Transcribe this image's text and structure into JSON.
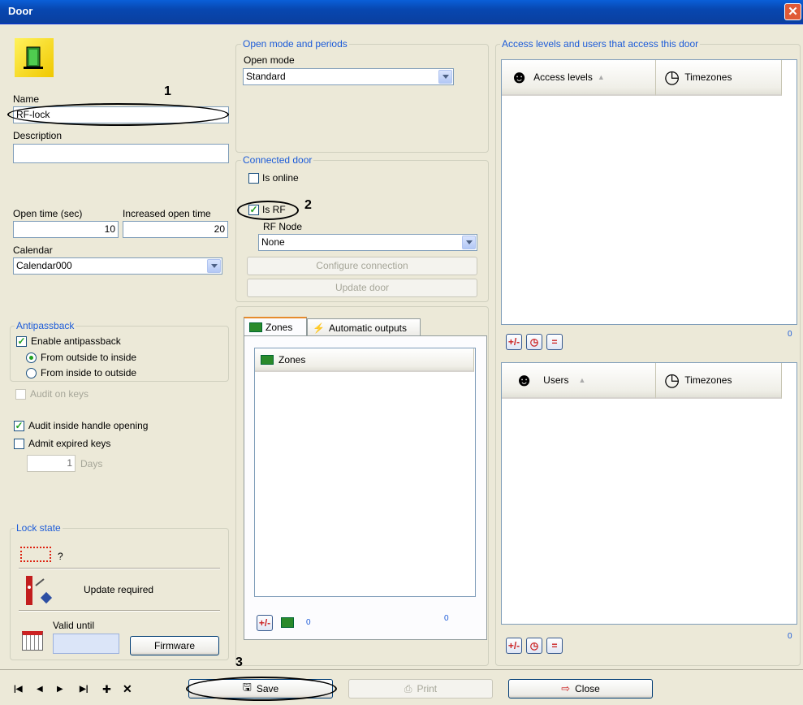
{
  "window": {
    "title": "Door",
    "close_glyph": "✕"
  },
  "name": {
    "label": "Name",
    "value": "RF-lock"
  },
  "description": {
    "label": "Description",
    "value": ""
  },
  "open_time": {
    "label": "Open time (sec)",
    "value": "10"
  },
  "increased_open_time": {
    "label": "Increased open time",
    "value": "20"
  },
  "calendar": {
    "label": "Calendar",
    "value": "Calendar000"
  },
  "antipassback": {
    "group_label": "Antipassback",
    "enable_label": "Enable antipassback",
    "outside_inside": "From outside to inside",
    "inside_outside": "From inside to outside"
  },
  "audit_on_keys": "Audit on keys",
  "audit_inside_handle": "Audit inside handle opening",
  "admit_expired_keys": "Admit expired keys",
  "days": {
    "value": "1",
    "label": "Days"
  },
  "lock_state": {
    "group_label": "Lock state",
    "question": "?",
    "update_required": "Update required",
    "valid_until": "Valid until",
    "firmware_button": "Firmware"
  },
  "open_mode": {
    "group_label": "Open mode and periods",
    "label": "Open mode",
    "value": "Standard"
  },
  "connected_door": {
    "group_label": "Connected door",
    "is_online": "Is online",
    "is_rf": "Is RF",
    "rf_node_label": "RF Node",
    "rf_node_value": "None",
    "configure_button": "Configure connection",
    "update_button": "Update door"
  },
  "tabs": {
    "zones": "Zones",
    "automatic_outputs": "Automatic outputs"
  },
  "zones_list": {
    "header": "Zones",
    "count_small": "0",
    "count_right": "0"
  },
  "access": {
    "group_label": "Access levels and users that access this door",
    "access_levels_header": "Access levels",
    "timezones_header": "Timezones",
    "access_count": "0",
    "users_header": "Users",
    "users_timezones_header": "Timezones",
    "users_count": "0",
    "sort_glyph": "▲"
  },
  "annotations": {
    "n1": "1",
    "n2": "2",
    "n3": "3"
  },
  "bottom": {
    "nav_first": "|◀",
    "nav_prev": "◀",
    "nav_next": "▶",
    "nav_last": "▶|",
    "nav_add": "✚",
    "nav_delete": "✕",
    "save_button": "Save",
    "print_button": "Print",
    "close_button": "Close"
  },
  "icons": {
    "add_remove": "+/-",
    "clear": "="
  }
}
